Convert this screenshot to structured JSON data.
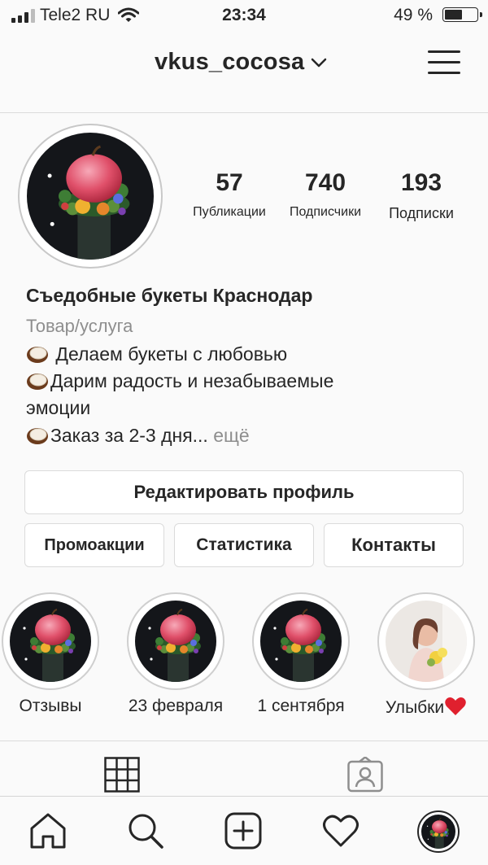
{
  "status_bar": {
    "carrier": "Tele2 RU",
    "time": "23:34",
    "battery": "49 %",
    "battery_level": 0.49
  },
  "header": {
    "username": "vkus_cocosa",
    "icons": [
      "chevron-down-icon",
      "hamburger-menu-icon"
    ]
  },
  "profile": {
    "stats": [
      {
        "value": "57",
        "label": "Публикации"
      },
      {
        "value": "740",
        "label": "Подписчики"
      },
      {
        "value": "193",
        "label": "Подписки"
      }
    ],
    "name": "Съедобные букеты Краснодар",
    "category": "Товар/услуга",
    "bio_lines": [
      " Делаем букеты с любовью",
      "Дарим радость и незабываемые",
      "эмоции",
      "Заказ за 2-3 дня... "
    ],
    "bio_more": "ещё"
  },
  "buttons": {
    "edit_profile": "Редактировать профиль",
    "promotions": "Промоакции",
    "insights": "Статистика",
    "contacts": "Контакты"
  },
  "highlights": [
    {
      "label": "Отзывы"
    },
    {
      "label": "23 февраля"
    },
    {
      "label": "1 сентября"
    },
    {
      "label": "Улыбки"
    }
  ],
  "profile_tabs": [
    "grid-icon",
    "tagged-icon"
  ],
  "bottom_nav": [
    "home-icon",
    "search-icon",
    "new-post-icon",
    "heart-icon",
    "profile-avatar"
  ],
  "colors": {
    "text": "#262626",
    "secondary": "#8e8e8e",
    "border": "#dbdbdb",
    "heart": "#ed4956"
  }
}
